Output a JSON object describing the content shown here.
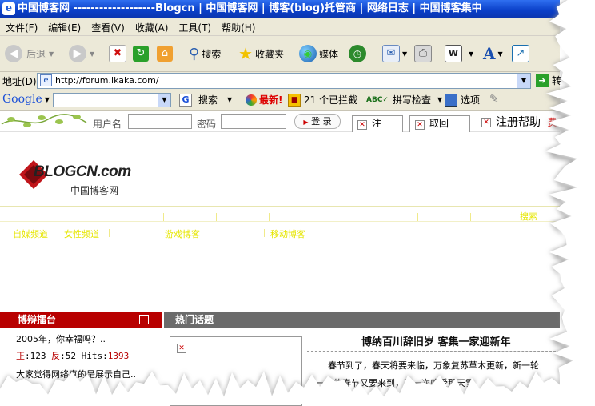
{
  "window": {
    "title": "中国博客网 -------------------Blogcn | 中国博客网 | 博客(blog)托管商 | 网络日志 | 中国博客集中"
  },
  "menu": [
    "文件(F)",
    "编辑(E)",
    "查看(V)",
    "收藏(A)",
    "工具(T)",
    "帮助(H)"
  ],
  "toolbar": {
    "back_label": "后退",
    "search_label": "搜索",
    "favorites_label": "收藏夹",
    "media_label": "媒体"
  },
  "address": {
    "label": "地址(D)",
    "url": "http://forum.ikaka.com/",
    "go_label": "转"
  },
  "google_bar": {
    "logo": "Google",
    "search_label": "搜索",
    "news_label": "最新!",
    "blocked_label": "21 个已拦截",
    "spellcheck_label": "拼写检查",
    "options_label": "选项"
  },
  "login": {
    "username_label": "用户名",
    "password_label": "密码",
    "login_button": "登 录",
    "reg_button": "注",
    "back_button": "取回",
    "help_label": "注册帮助",
    "extra_label": "费"
  },
  "site": {
    "logo_text": "BLOGCN.com",
    "logo_subtitle": "中国博客网",
    "search_link": "搜索",
    "nav": [
      "自媒频道",
      "女性频道",
      "游戏博客",
      "移动博客"
    ]
  },
  "left_panel": {
    "title": "博辩擂台",
    "items": [
      {
        "text": "2005年，你幸福吗？.."
      },
      {
        "pro_label": "正",
        "pro": ":123",
        "con_label": "反",
        "con": ":52",
        "hits_label": "Hits:",
        "hits": "1393"
      },
      {
        "text": "大家觉得网络真的是展示自己.."
      }
    ]
  },
  "right_panel": {
    "title": "热门话题",
    "headline": "博纳百川辞旧岁 客集一家迎新年",
    "body_line1": "春节到了，春天将要来临，万象复苏草木更新，新一轮",
    "body_line2": "年一度的春节又要来到，再一次感受那天雪"
  },
  "colors": {
    "titlebar": "#0a3fc8",
    "chrome": "#ece9d8",
    "left_header": "#b80000",
    "right_header": "#6b6b6b",
    "nav_link": "#e6e600",
    "logo_red": "#c0151b",
    "hits": "#b80000"
  }
}
